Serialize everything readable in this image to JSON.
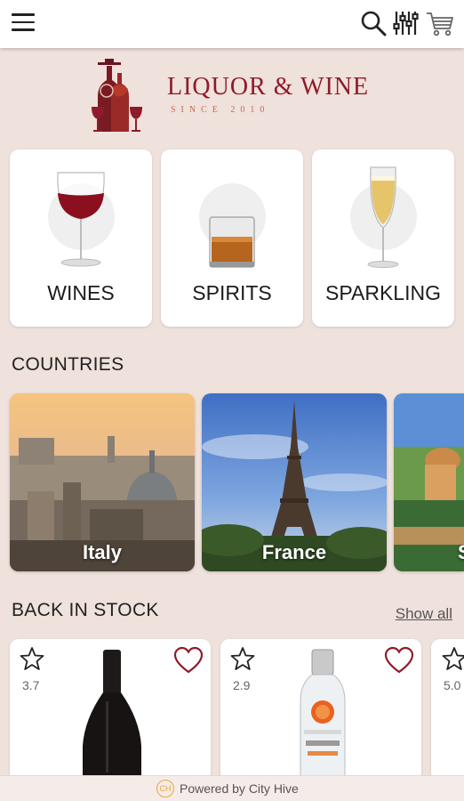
{
  "header": {
    "menu_icon": "hamburger-icon",
    "search_icon": "search-icon",
    "filter_icon": "filter-icon",
    "cart_icon": "cart-icon"
  },
  "brand": {
    "name": "LIQUOR & WINE",
    "tagline": "SINCE 2010",
    "color": "#8e1b2a"
  },
  "categories": [
    {
      "label": "WINES",
      "icon": "wine-glass-icon"
    },
    {
      "label": "SPIRITS",
      "icon": "whiskey-glass-icon"
    },
    {
      "label": "SPARKLING",
      "icon": "champagne-flute-icon"
    }
  ],
  "countries_section": {
    "title": "COUNTRIES",
    "items": [
      {
        "name": "Italy"
      },
      {
        "name": "France"
      },
      {
        "name": "S"
      }
    ]
  },
  "back_in_stock": {
    "title": "BACK IN STOCK",
    "show_all_label": "Show all",
    "products": [
      {
        "rating": "3.7",
        "image": "red-wine-bottle"
      },
      {
        "rating": "2.9",
        "image": "ciroc-vodka-bottle"
      },
      {
        "rating": "5.0",
        "image": "bottle"
      }
    ]
  },
  "footer": {
    "powered_by": "Powered by City Hive",
    "logo_text": "CH"
  }
}
